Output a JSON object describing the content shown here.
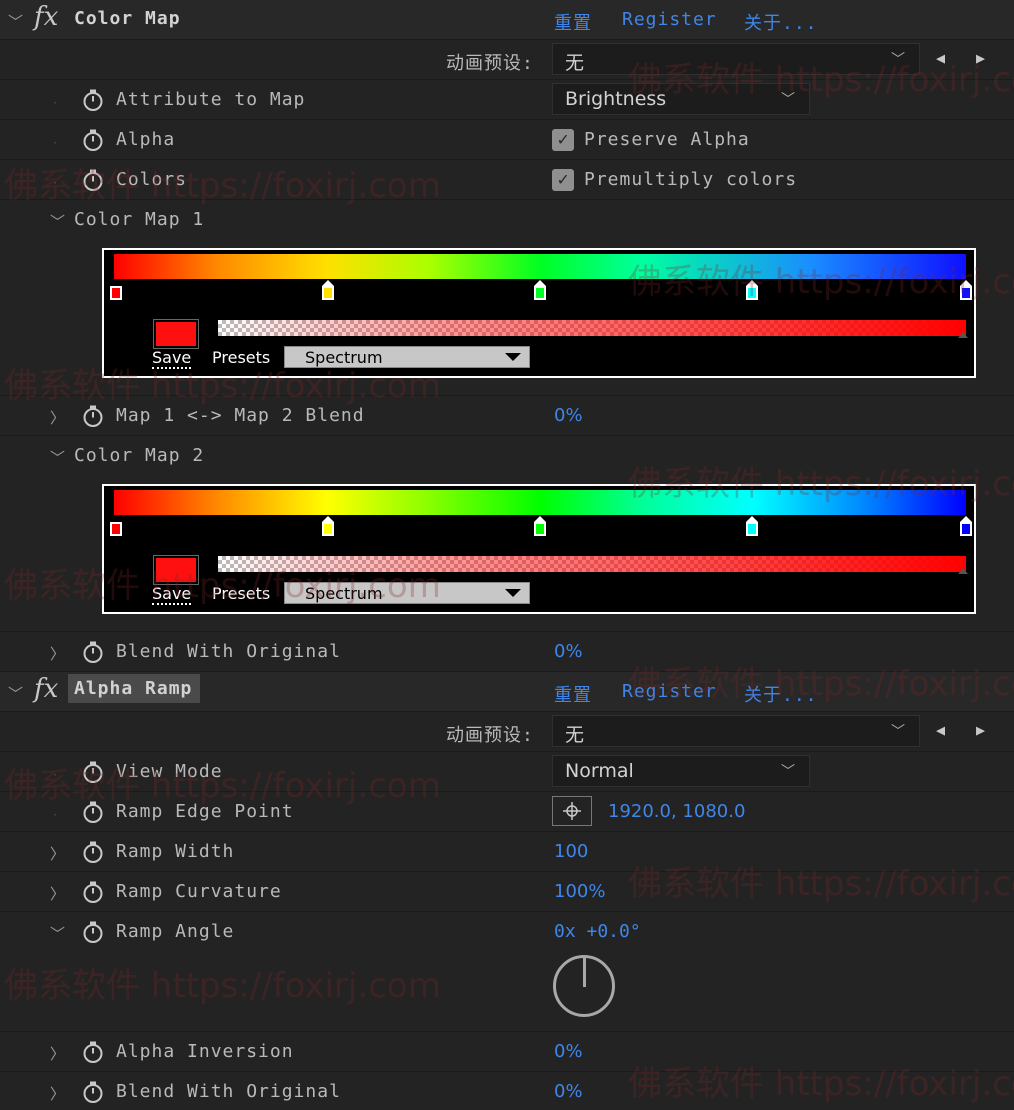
{
  "effects": [
    {
      "name": "Color Map",
      "actions": {
        "reset": "重置",
        "register": "Register",
        "about": "关于..."
      },
      "preset_label": "动画预设:",
      "preset_value": "无"
    },
    {
      "name": "Alpha Ramp",
      "actions": {
        "reset": "重置",
        "register": "Register",
        "about": "关于..."
      },
      "preset_label": "动画预设:",
      "preset_value": "无"
    }
  ],
  "color_map": {
    "attribute_label": "Attribute to Map",
    "attribute_value": "Brightness",
    "alpha_label": "Alpha",
    "preserve_alpha_label": "Preserve Alpha",
    "preserve_alpha_checked": true,
    "colors_label": "Colors",
    "premultiply_label": "Premultiply colors",
    "premultiply_checked": true,
    "map1_label": "Color Map 1",
    "map1": {
      "save": "Save",
      "presets": "Presets",
      "preset_value": "Spectrum"
    },
    "blend_maps_label": "Map 1 <-> Map 2 Blend",
    "blend_maps_value": "0%",
    "map2_label": "Color Map 2",
    "map2": {
      "save": "Save",
      "presets": "Presets",
      "preset_value": "Spectrum"
    },
    "blend_original_label": "Blend With Original",
    "blend_original_value": "0%"
  },
  "alpha_ramp": {
    "view_mode_label": "View Mode",
    "view_mode_value": "Normal",
    "edge_point_label": "Ramp Edge Point",
    "edge_point_value": "1920.0, 1080.0",
    "width_label": "Ramp Width",
    "width_value": "100",
    "curvature_label": "Ramp Curvature",
    "curvature_value": "100%",
    "angle_label": "Ramp Angle",
    "angle_value": "0x +0.0°",
    "inversion_label": "Alpha Inversion",
    "inversion_value": "0%",
    "blend_original_label": "Blend With Original",
    "blend_original_value": "0%"
  },
  "watermark": "佛系软件 https://foxirj.com",
  "colors": {
    "link": "#3f86e8",
    "panel_bg": "#232323",
    "checkbox": "#8f8f8f"
  }
}
